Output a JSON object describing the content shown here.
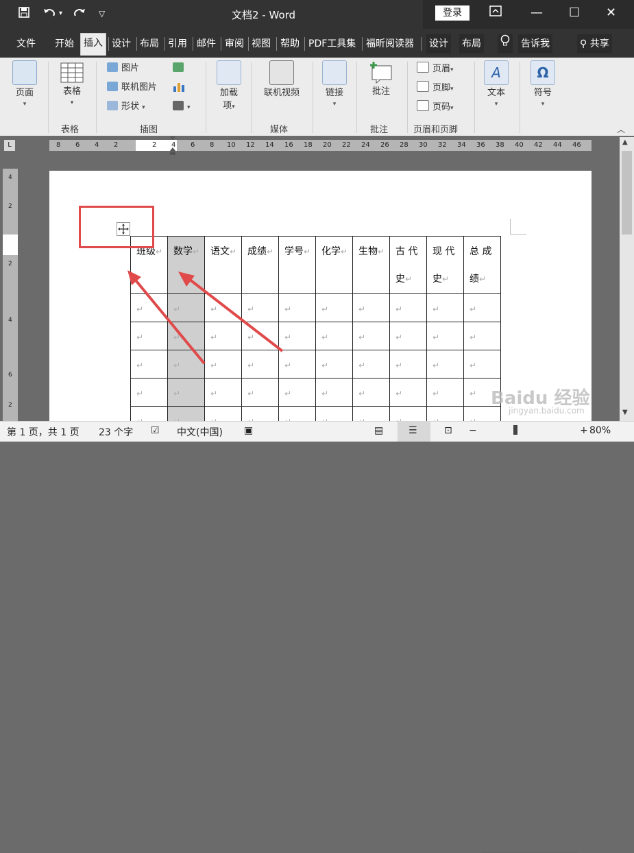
{
  "title_bar": {
    "doc_title": "文档2 - Word",
    "login_label": "登录",
    "quick_access": [
      "save-icon",
      "undo-icon",
      "redo-icon",
      "customize-icon"
    ]
  },
  "tabs": [
    "文件",
    "开始",
    "插入",
    "设计",
    "布局",
    "引用",
    "邮件",
    "审阅",
    "视图",
    "帮助",
    "PDF工具集",
    "福昕阅读器"
  ],
  "active_tab": "插入",
  "context_tabs": [
    "设计",
    "布局"
  ],
  "tell_me": "告诉我",
  "share": "共享",
  "ribbon": {
    "pages": {
      "label": "页面",
      "group": ""
    },
    "table": {
      "label": "表格",
      "group": "表格"
    },
    "illustrations": {
      "items": [
        "图片",
        "联机图片",
        "形状"
      ],
      "group": "插图"
    },
    "addins": {
      "label1": "加载",
      "label2": "项"
    },
    "media": {
      "label": "联机视频",
      "group": "媒体"
    },
    "links": {
      "label": "链接"
    },
    "comments": {
      "label": "批注",
      "group": "批注"
    },
    "header_footer": {
      "items": [
        "页眉",
        "页脚",
        "页码"
      ],
      "group": "页眉和页脚"
    },
    "text": {
      "label": "文本"
    },
    "symbols": {
      "label": "符号"
    }
  },
  "ruler": {
    "corner": "L",
    "numbers": [
      "8",
      "6",
      "4",
      "2",
      "",
      "2",
      "4",
      "6",
      "8",
      "10",
      "12",
      "14",
      "16",
      "18",
      "20",
      "22",
      "24",
      "26",
      "28",
      "30",
      "32",
      "34",
      "36",
      "38",
      "40",
      "42",
      "44",
      "46"
    ],
    "vnumbers": [
      "4",
      "2",
      "",
      "2",
      "4",
      "6",
      "",
      "2"
    ]
  },
  "table": {
    "headers": [
      [
        "班级"
      ],
      [
        "数学"
      ],
      [
        "语文"
      ],
      [
        "成绩"
      ],
      [
        "学号"
      ],
      [
        "化学"
      ],
      [
        "生物"
      ],
      [
        "古 代",
        "史"
      ],
      [
        "现 代",
        "史"
      ],
      [
        "总 成",
        "绩"
      ]
    ],
    "empty_rows": 5,
    "para_mark": "↵",
    "selected_col": 1
  },
  "status": {
    "page": "第 1 页，共 1 页",
    "words": "23 个字",
    "lang": "中文(中国)",
    "zoom": "80%"
  },
  "watermark": {
    "line1": "Baidu 经验",
    "line2": "jingyan.baidu.com"
  },
  "colors": {
    "accent_red": "#e04a4a",
    "title_bg": "#333333",
    "ribbon_bg": "#ececec"
  }
}
